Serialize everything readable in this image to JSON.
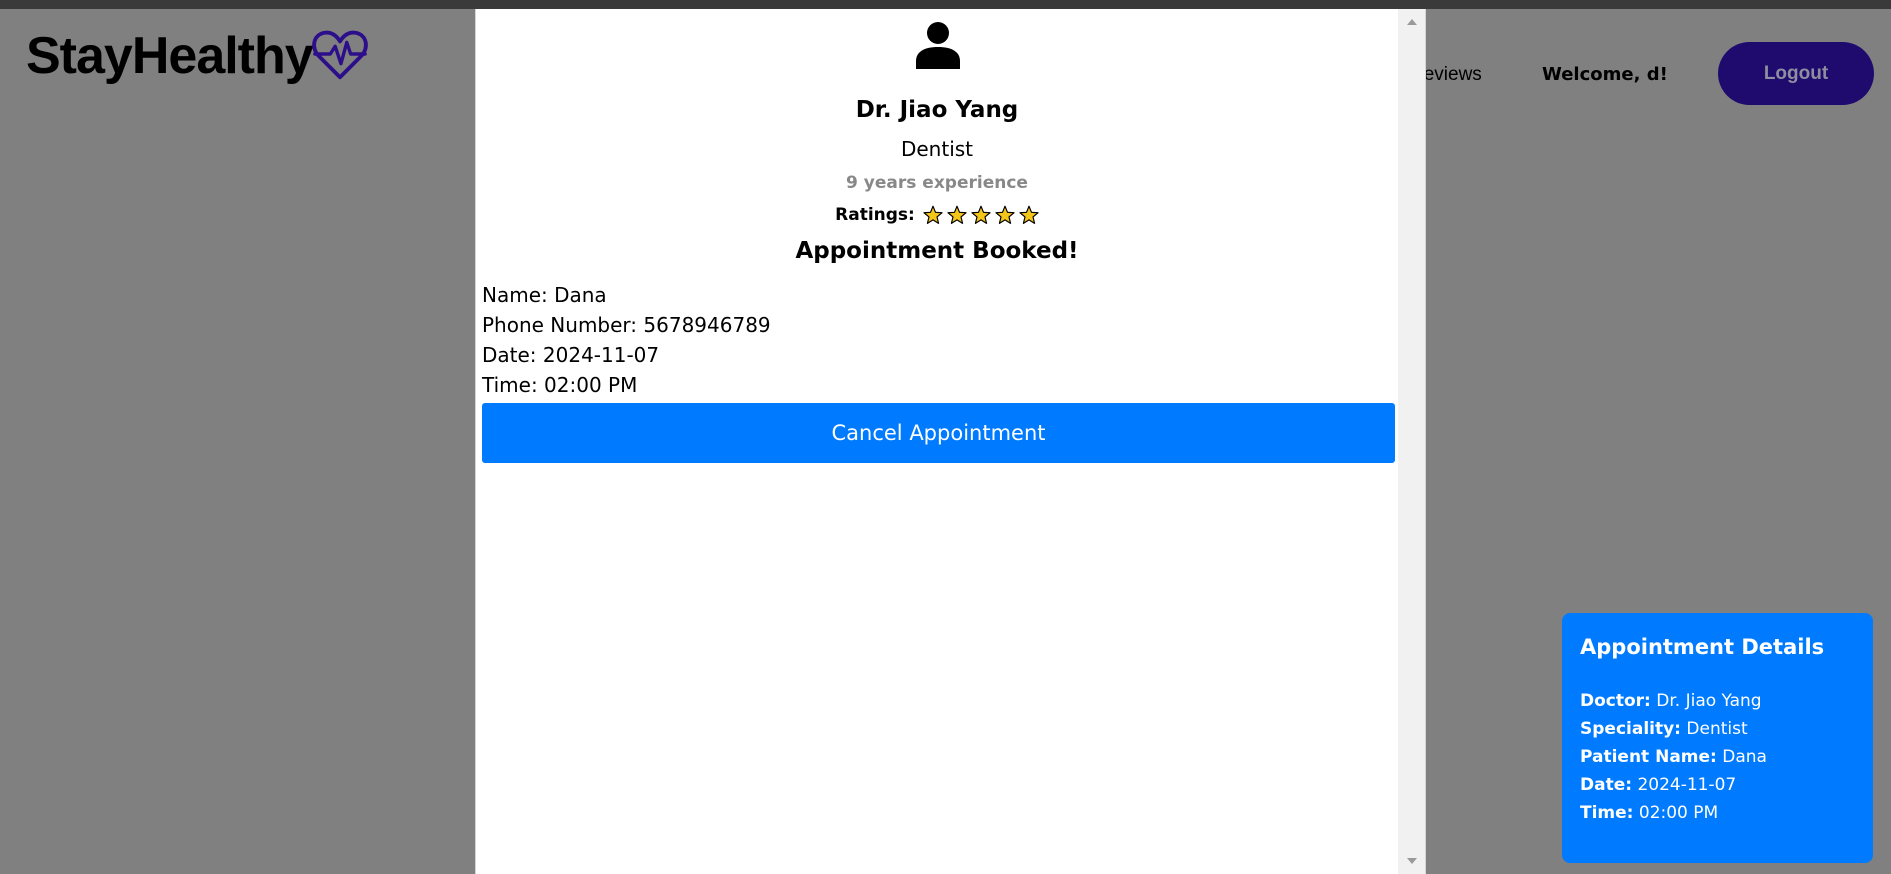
{
  "header": {
    "logo_text": "StayHealthy",
    "nav_reviews": "Reviews",
    "welcome": "Welcome, d!",
    "logout_label": "Logout"
  },
  "modal": {
    "doctor_name": "Dr. Jiao Yang",
    "speciality": "Dentist",
    "experience": "9 years experience",
    "ratings_label": "Ratings:",
    "rating_stars": 5,
    "booked_title": "Appointment Booked!",
    "name_line": "Name: Dana",
    "phone_line": "Phone Number: 5678946789",
    "date_line": "Date: 2024-11-07",
    "time_line": "Time: 02:00 PM",
    "cancel_label": "Cancel Appointment"
  },
  "details": {
    "title": "Appointment Details",
    "doctor_label": "Doctor:",
    "doctor_value": " Dr. Jiao Yang",
    "speciality_label": "Speciality:",
    "speciality_value": " Dentist",
    "patient_label": "Patient Name:",
    "patient_value": " Dana",
    "date_label": "Date:",
    "date_value": " 2024-11-07",
    "time_label": "Time:",
    "time_value": " 02:00 PM"
  },
  "colors": {
    "primary": "#007bff",
    "logo_accent": "#2d0e8a",
    "logout_bg": "#1f0a6e",
    "star": "#f5c518",
    "overlay": "#808080"
  }
}
